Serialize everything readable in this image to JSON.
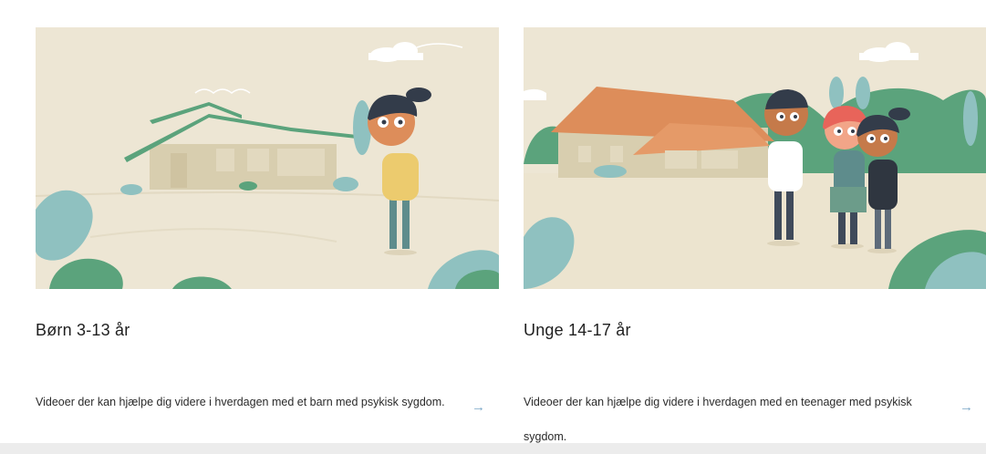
{
  "cards": [
    {
      "title": "Børn 3-13 år",
      "description": "Videoer der kan hjælpe dig videre i hverdagen med et barn med psykisk sygdom.",
      "arrow": "→",
      "image_icon": "illustration-child-house"
    },
    {
      "title": "Unge 14-17 år",
      "description": "Videoer der kan hjælpe dig videre i hverdagen med en teenager med psykisk sygdom.",
      "arrow": "→",
      "image_icon": "illustration-teens-farmhouse"
    }
  ],
  "colors": {
    "background": "#ede6d4",
    "green": "#5ba37c",
    "teal": "#8fc1c0",
    "roof": "#dd8d5a",
    "arrow": "#7aa7c7"
  }
}
